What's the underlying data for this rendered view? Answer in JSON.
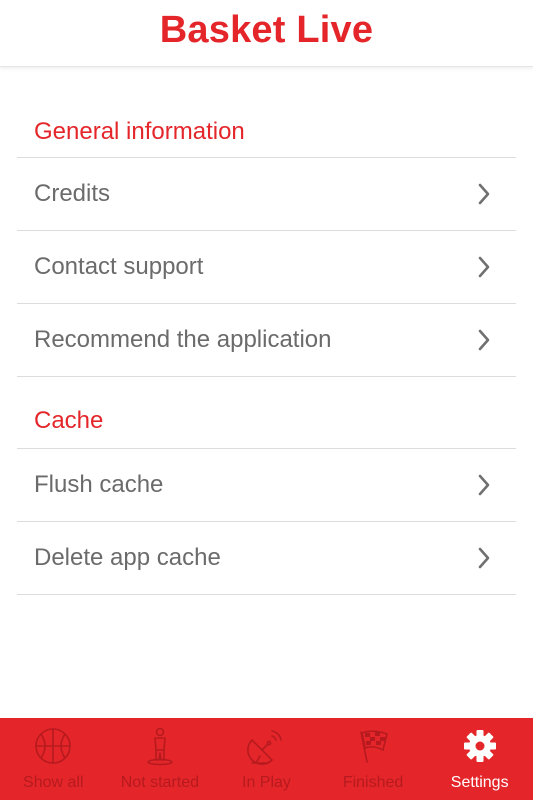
{
  "header": {
    "title": "Basket Live"
  },
  "sections": [
    {
      "title": "General information",
      "items": [
        {
          "label": "Credits"
        },
        {
          "label": "Contact support"
        },
        {
          "label": "Recommend the application"
        }
      ]
    },
    {
      "title": "Cache",
      "items": [
        {
          "label": "Flush cache"
        },
        {
          "label": "Delete app cache"
        }
      ]
    }
  ],
  "tabbar": {
    "tabs": [
      {
        "label": "Show all",
        "icon": "basketball-icon",
        "active": false
      },
      {
        "label": "Not started",
        "icon": "player-standing-icon",
        "active": false
      },
      {
        "label": "In Play",
        "icon": "satellite-dish-icon",
        "active": false
      },
      {
        "label": "Finished",
        "icon": "checkered-flag-icon",
        "active": false
      },
      {
        "label": "Settings",
        "icon": "gear-icon",
        "active": true
      }
    ]
  },
  "colors": {
    "accent": "#e4262a",
    "inactive_tab": "#b61a1e",
    "row_text": "#6b6b6b",
    "divider": "#dcdcdc"
  }
}
